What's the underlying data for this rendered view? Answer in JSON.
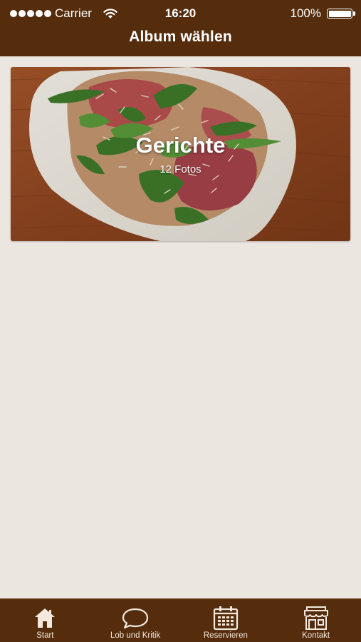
{
  "status_bar": {
    "carrier": "Carrier",
    "time": "16:20",
    "battery": "100%"
  },
  "header": {
    "title": "Album wählen"
  },
  "albums": [
    {
      "title": "Gerichte",
      "count": "12 Fotos"
    }
  ],
  "tab_bar": {
    "tabs": [
      {
        "label": "Start",
        "icon": "home-icon"
      },
      {
        "label": "Lob und Kritik",
        "icon": "speech-bubble-icon"
      },
      {
        "label": "Reservieren",
        "icon": "calendar-icon"
      },
      {
        "label": "Kontakt",
        "icon": "storefront-icon"
      }
    ]
  },
  "colors": {
    "bar_background": "#552d0d",
    "page_background": "#ece6e1",
    "text_on_bar": "#ffffff"
  }
}
